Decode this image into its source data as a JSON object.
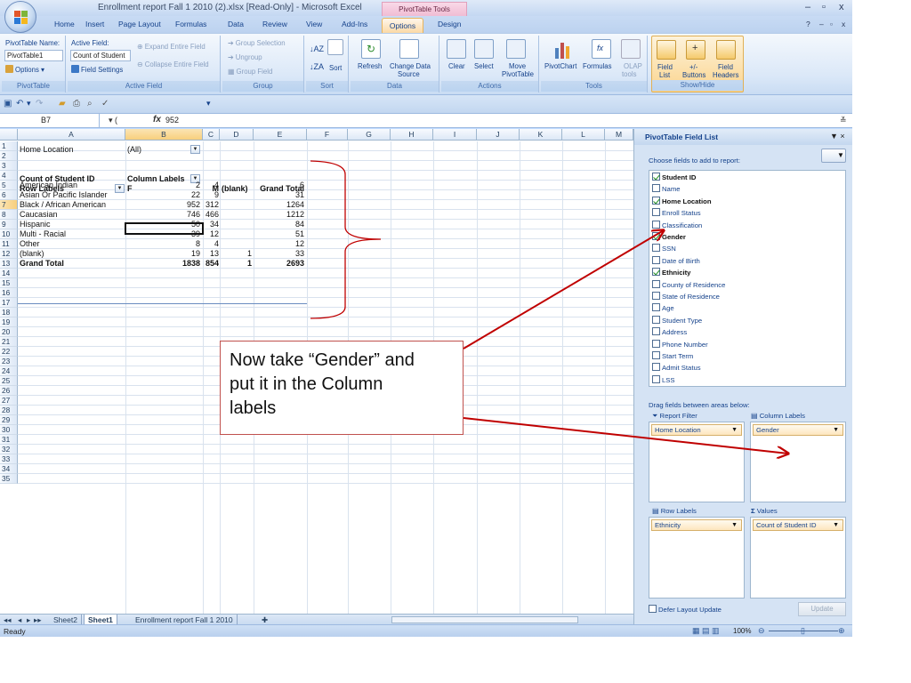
{
  "app": {
    "title": "Enrollment report Fall 1 2010 (2).xlsx  [Read-Only] - Microsoft Excel",
    "context_tools": "PivotTable Tools",
    "window_controls": [
      "–",
      "▫",
      "x"
    ]
  },
  "tabs": [
    "Home",
    "Insert",
    "Page Layout",
    "Formulas",
    "Data",
    "Review",
    "View",
    "Add-Ins",
    "Options",
    "Design"
  ],
  "active_tab": "Options",
  "ribbon": {
    "pivottable": {
      "name_label": "PivotTable Name:",
      "name_value": "PivotTable1",
      "options": "Options",
      "group": "PivotTable"
    },
    "active_field": {
      "label": "Active Field:",
      "value": "Count of Student",
      "field_settings": "Field Settings",
      "expand": "Expand Entire Field",
      "collapse": "Collapse Entire Field",
      "group": "Active Field"
    },
    "group_grp": {
      "selection": "Group Selection",
      "ungroup": "Ungroup",
      "field": "Group Field",
      "group": "Group"
    },
    "sort": {
      "sort": "Sort",
      "group": "Sort"
    },
    "data": {
      "refresh": "Refresh",
      "change1": "Change Data",
      "change2": "Source",
      "group": "Data"
    },
    "actions": {
      "clear": "Clear",
      "select": "Select",
      "move1": "Move",
      "move2": "PivotTable",
      "group": "Actions"
    },
    "tools": {
      "chart": "PivotChart",
      "formulas": "Formulas",
      "olap1": "OLAP",
      "olap2": "tools",
      "group": "Tools"
    },
    "showhide": {
      "fl1": "Field",
      "fl2": "List",
      "pm1": "+/-",
      "pm2": "Buttons",
      "fh1": "Field",
      "fh2": "Headers",
      "group": "Show/Hide"
    }
  },
  "formula_bar": {
    "cell_ref": "B7",
    "fx": "fx",
    "value": "952"
  },
  "columns": [
    "A",
    "B",
    "C",
    "D",
    "E",
    "F",
    "G",
    "H",
    "I",
    "J",
    "K",
    "L",
    "M"
  ],
  "rows": [
    "1",
    "2",
    "3",
    "4",
    "5",
    "6",
    "7",
    "8",
    "9",
    "10",
    "11",
    "12",
    "13",
    "14",
    "15",
    "16",
    "17",
    "18",
    "19",
    "20",
    "21",
    "22",
    "23",
    "24",
    "25",
    "26",
    "27",
    "28",
    "29",
    "30",
    "31",
    "32",
    "33",
    "34",
    "35"
  ],
  "pivot": {
    "filter_label": "Home Location",
    "filter_value": "(All)",
    "count_label": "Count of Student ID",
    "col_labels": "Column Labels",
    "row_labels": "Row Labels",
    "headers": [
      "F",
      "M",
      "(blank)",
      "Grand Total"
    ],
    "data": [
      [
        "American Indian",
        "2",
        "4",
        "",
        "6"
      ],
      [
        "Asian Or Pacific Islander",
        "22",
        "9",
        "",
        "31"
      ],
      [
        "Black / African American",
        "952",
        "312",
        "",
        "1264"
      ],
      [
        "Caucasian",
        "746",
        "466",
        "",
        "1212"
      ],
      [
        "Hispanic",
        "50",
        "34",
        "",
        "84"
      ],
      [
        "Multi - Racial",
        "39",
        "12",
        "",
        "51"
      ],
      [
        "Other",
        "8",
        "4",
        "",
        "12"
      ],
      [
        "(blank)",
        "19",
        "13",
        "1",
        "33"
      ]
    ],
    "grand_total": [
      "Grand Total",
      "1838",
      "854",
      "1",
      "2693"
    ]
  },
  "callout": {
    "lines": [
      "Now take “Gender” and",
      "put it in the Column",
      "labels"
    ]
  },
  "sheet_tabs": [
    "Sheet2",
    "Sheet1",
    "Enrollment report Fall 1 2010"
  ],
  "active_sheet": "Sheet1",
  "status": {
    "ready": "Ready",
    "zoom": "100%"
  },
  "field_list": {
    "title": "PivotTable Field List",
    "choose": "Choose fields to add to report:",
    "fields": [
      {
        "name": "Student ID",
        "checked": true
      },
      {
        "name": "Name",
        "checked": false
      },
      {
        "name": "Home Location",
        "checked": true
      },
      {
        "name": "Enroll Status",
        "checked": false
      },
      {
        "name": "Classification",
        "checked": false
      },
      {
        "name": "Gender",
        "checked": true
      },
      {
        "name": "SSN",
        "checked": false
      },
      {
        "name": "Date of Birth",
        "checked": false
      },
      {
        "name": "Ethnicity",
        "checked": true
      },
      {
        "name": "County of Residence",
        "checked": false
      },
      {
        "name": "State of Residence",
        "checked": false
      },
      {
        "name": "Age",
        "checked": false
      },
      {
        "name": "Student Type",
        "checked": false
      },
      {
        "name": "Address",
        "checked": false
      },
      {
        "name": "Phone Number",
        "checked": false
      },
      {
        "name": "Start Term",
        "checked": false
      },
      {
        "name": "Admit Status",
        "checked": false
      },
      {
        "name": "LSS",
        "checked": false
      }
    ],
    "drag_label": "Drag fields between areas below:",
    "report_filter": "Report Filter",
    "column_labels": "Column Labels",
    "row_labels": "Row Labels",
    "values": "Values",
    "filter_item": "Home Location",
    "column_item": "Gender",
    "row_item": "Ethnicity",
    "value_item": "Count of Student ID",
    "defer": "Defer Layout Update",
    "update": "Update"
  },
  "colors": {
    "accent": "#15428b",
    "arrow": "#c00000",
    "callout_border": "#c0504d",
    "ribbon": "#dbe8f8"
  }
}
